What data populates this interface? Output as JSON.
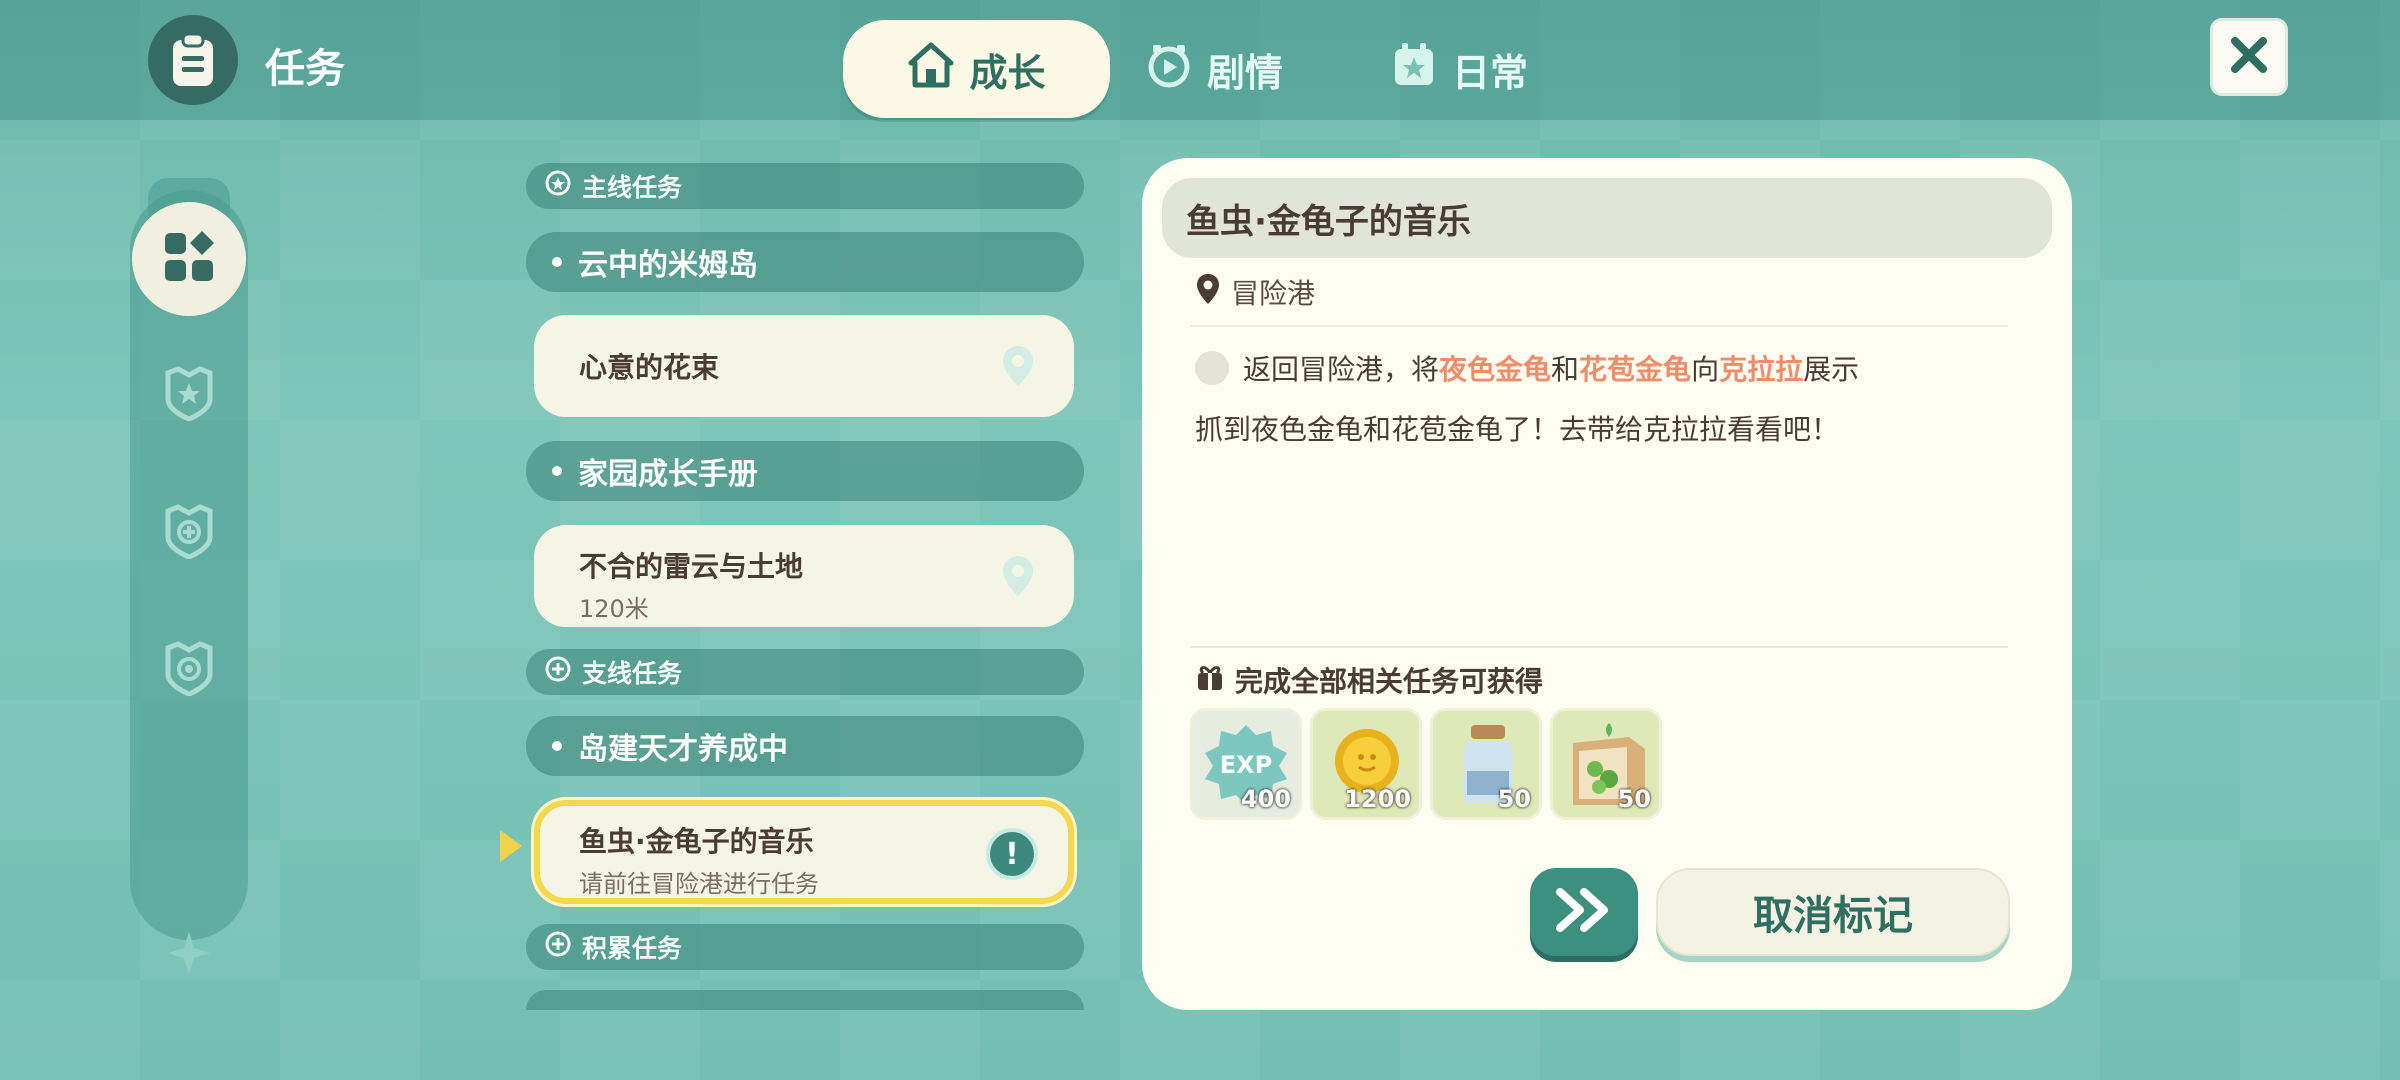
{
  "header": {
    "title": "任务",
    "tabs": [
      {
        "label": "成长",
        "active": true
      },
      {
        "label": "剧情",
        "active": false
      },
      {
        "label": "日常",
        "active": false
      }
    ]
  },
  "quest_list": {
    "sections": {
      "main": "主线任务",
      "side": "支线任务",
      "accum": "积累任务"
    },
    "groups": {
      "g1": "云中的米姆岛",
      "g2": "家园成长手册",
      "g3": "岛建天才养成中"
    },
    "quests": {
      "q1": {
        "name": "心意的花束"
      },
      "q2": {
        "name": "不合的雷云与土地",
        "distance": "120米"
      },
      "q3": {
        "name": "鱼虫·金龟子的音乐",
        "hint": "请前往冒险港进行任务"
      }
    }
  },
  "detail": {
    "title": "鱼虫·金龟子的音乐",
    "location": "冒险港",
    "objective": {
      "p1": "返回冒险港，将",
      "h1": "夜色金龟",
      "p2": "和",
      "h2": "花苞金龟",
      "p3": "向",
      "h3": "克拉拉",
      "p4": "展示"
    },
    "description": "抓到夜色金龟和花苞金龟了！去带给克拉拉看看吧！",
    "reward_title": "完成全部相关任务可获得",
    "rewards": [
      {
        "name": "EXP",
        "count": "400"
      },
      {
        "name": "coin",
        "count": "1200"
      },
      {
        "name": "jar",
        "count": "50"
      },
      {
        "name": "seed-pack",
        "count": "50"
      }
    ],
    "cancel_label": "取消标记"
  },
  "colors": {
    "accent": "#3d8f7f",
    "highlight": "#f08c6a",
    "selected_border": "#f4d64f"
  }
}
